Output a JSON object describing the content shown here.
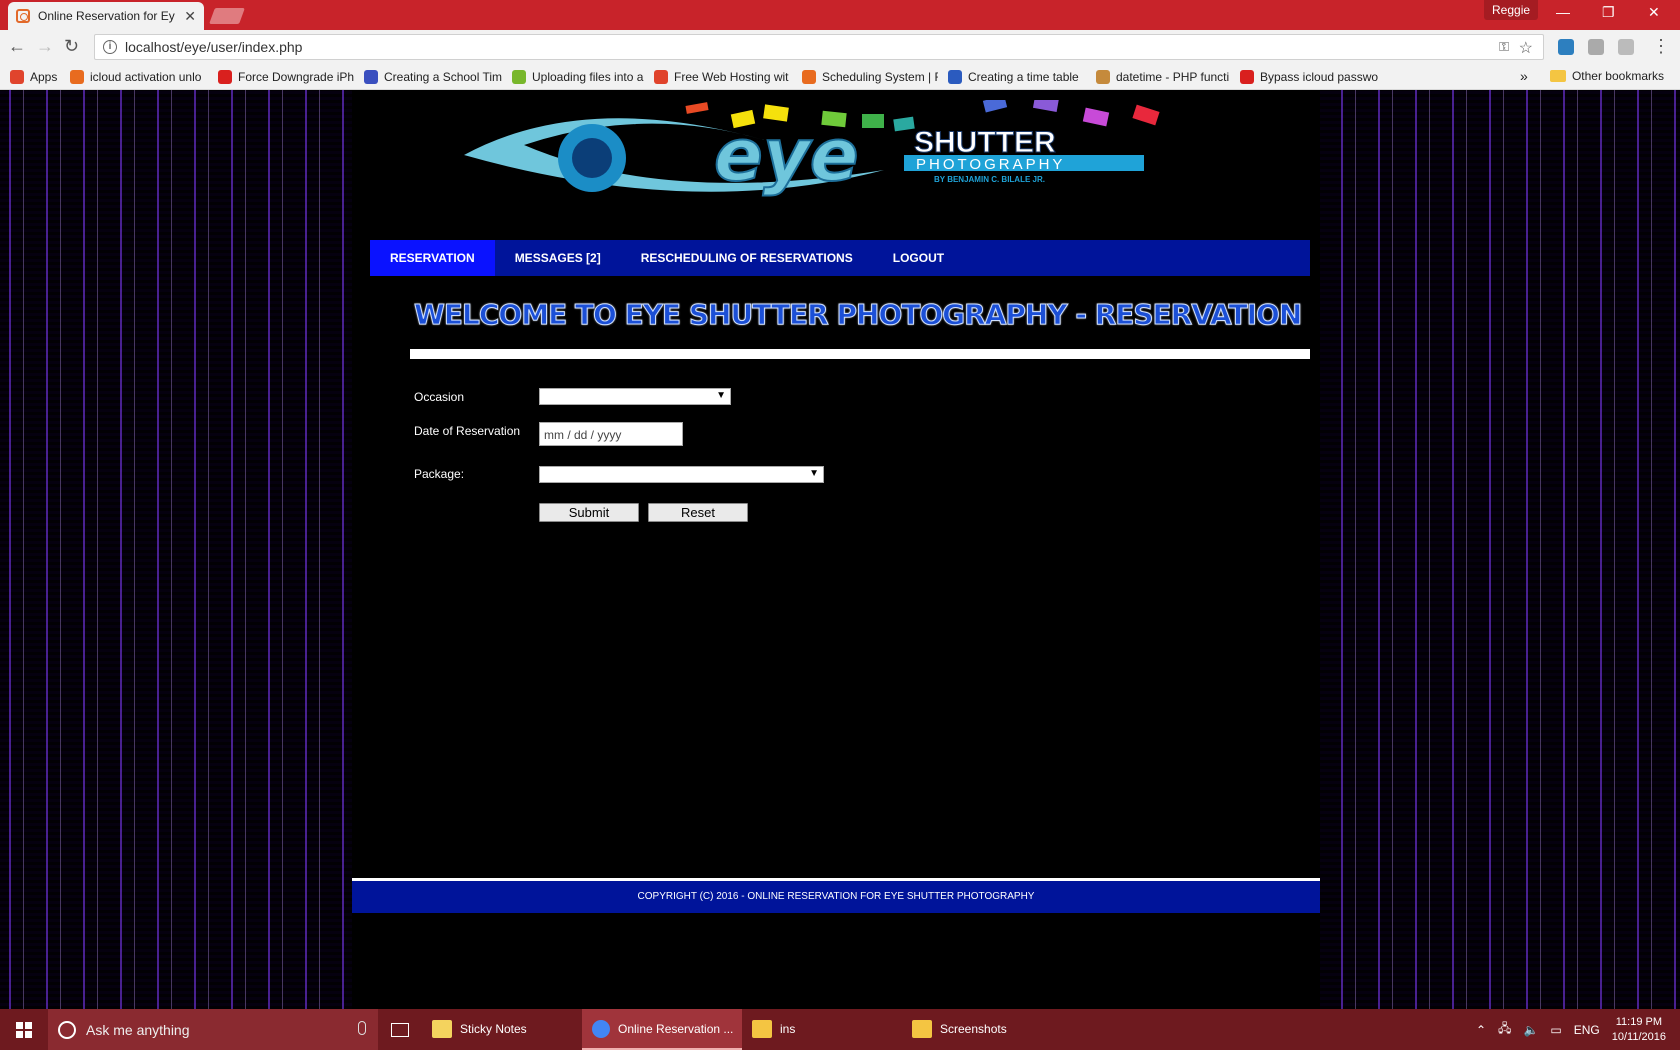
{
  "browser": {
    "tab_title": "Online Reservation for Ey",
    "profile": "Reggie",
    "url": "localhost/eye/user/index.php",
    "bookmarks": [
      {
        "label": "Apps",
        "color": "#e0442d"
      },
      {
        "label": "icloud activation unlo",
        "color": "#e86b1f"
      },
      {
        "label": "Force Downgrade iPh",
        "color": "#d9201e"
      },
      {
        "label": "Creating a School Tim",
        "color": "#3a4fbf"
      },
      {
        "label": "Uploading files into a",
        "color": "#78b72b"
      },
      {
        "label": "Free Web Hosting wit",
        "color": "#e0432b"
      },
      {
        "label": "Scheduling System | F",
        "color": "#e86b1f"
      },
      {
        "label": "Creating a time table",
        "color": "#2b5bbf"
      },
      {
        "label": "datetime - PHP functi",
        "color": "#c58a3c"
      },
      {
        "label": "Bypass icloud passwo",
        "color": "#d9201e"
      }
    ],
    "other_bookmarks": "Other bookmarks"
  },
  "site": {
    "logo": {
      "wordmark": "eye",
      "brand": "SHUTTER",
      "subtitle": "PHOTOGRAPHY",
      "byline": "BY BENJAMIN C. BILALE JR."
    },
    "nav": [
      {
        "label": "RESERVATION",
        "active": true
      },
      {
        "label": "MESSAGES [2]",
        "active": false
      },
      {
        "label": "RESCHEDULING OF RESERVATIONS",
        "active": false
      },
      {
        "label": "LOGOUT",
        "active": false
      }
    ],
    "heading": "WELCOME TO EYE SHUTTER PHOTOGRAPHY - RESERVATION",
    "form": {
      "occasion_label": "Occasion",
      "occasion_value": "",
      "date_label": "Date of Reservation",
      "date_placeholder": "mm / dd / yyyy",
      "package_label": "Package:",
      "package_value": "",
      "submit": "Submit",
      "reset": "Reset"
    },
    "footer": "COPYRIGHT (C) 2016 - ONLINE RESERVATION FOR EYE SHUTTER PHOTOGRAPHY"
  },
  "taskbar": {
    "search_placeholder": "Ask me anything",
    "items": [
      {
        "label": "Sticky Notes",
        "active": false,
        "color": "#f4d35e"
      },
      {
        "label": "Online Reservation ...",
        "active": true,
        "color": "#4285f4"
      },
      {
        "label": "ins",
        "active": false,
        "color": "#f4c542"
      },
      {
        "label": "Screenshots",
        "active": false,
        "color": "#f4c542"
      }
    ],
    "language": "ENG",
    "time": "11:19 PM",
    "date": "10/11/2016"
  },
  "colors": {
    "chrome_red": "#c8232a",
    "nav_blue": "#00149a",
    "nav_active": "#0a12ff",
    "taskbar": "#6e1a1f"
  }
}
